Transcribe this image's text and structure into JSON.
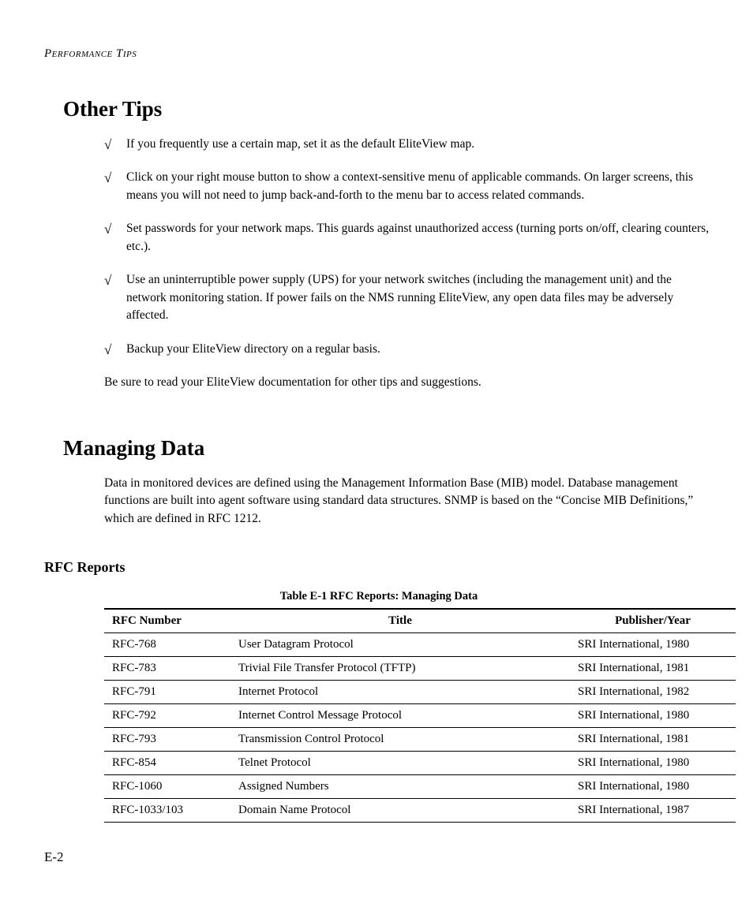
{
  "running_head": "Performance Tips",
  "sections": {
    "other_tips": {
      "heading": "Other Tips",
      "items": [
        "If you frequently use a certain map, set it as the default EliteView map.",
        "Click on your right mouse button to show a context-sensitive menu of applicable commands. On larger screens, this means you will not need to jump back-and-forth to the menu bar to access related commands.",
        "Set passwords for your network maps. This guards against unauthorized access (turning ports on/off, clearing counters, etc.).",
        "Use an uninterruptible power supply (UPS) for your network switches (including the management unit) and the network monitoring station. If power fails on the NMS running EliteView, any open data files may be adversely affected.",
        "Backup your EliteView directory on a regular basis."
      ],
      "trailer": "Be sure to read your EliteView documentation for other tips and suggestions."
    },
    "managing_data": {
      "heading": "Managing Data",
      "intro": "Data in monitored devices are defined using the Management Information Base (MIB) model. Database management functions are built into agent software using standard data structures. SNMP is based on the “Concise MIB Definitions,” which are defined in RFC 1212.",
      "subheading": "RFC Reports",
      "table_caption": "Table E-1  RFC Reports: Managing Data",
      "table_headers": {
        "rfc": "RFC Number",
        "title": "Title",
        "pub": "Publisher/Year"
      },
      "rows": [
        {
          "rfc": "RFC-768",
          "title": "User Datagram Protocol",
          "pub": "SRI International, 1980"
        },
        {
          "rfc": "RFC-783",
          "title": "Trivial File Transfer Protocol (TFTP)",
          "pub": "SRI International, 1981"
        },
        {
          "rfc": "RFC-791",
          "title": "Internet Protocol",
          "pub": "SRI International, 1982"
        },
        {
          "rfc": "RFC-792",
          "title": "Internet Control Message Protocol",
          "pub": "SRI International, 1980"
        },
        {
          "rfc": "RFC-793",
          "title": "Transmission Control Protocol",
          "pub": "SRI International, 1981"
        },
        {
          "rfc": "RFC-854",
          "title": "Telnet Protocol",
          "pub": "SRI International, 1980"
        },
        {
          "rfc": "RFC-1060",
          "title": "Assigned Numbers",
          "pub": "SRI International, 1980"
        },
        {
          "rfc": "RFC-1033/103",
          "title": "Domain Name Protocol",
          "pub": "SRI International, 1987"
        }
      ]
    }
  },
  "page_number": "E-2",
  "icons": {
    "check": "√"
  }
}
